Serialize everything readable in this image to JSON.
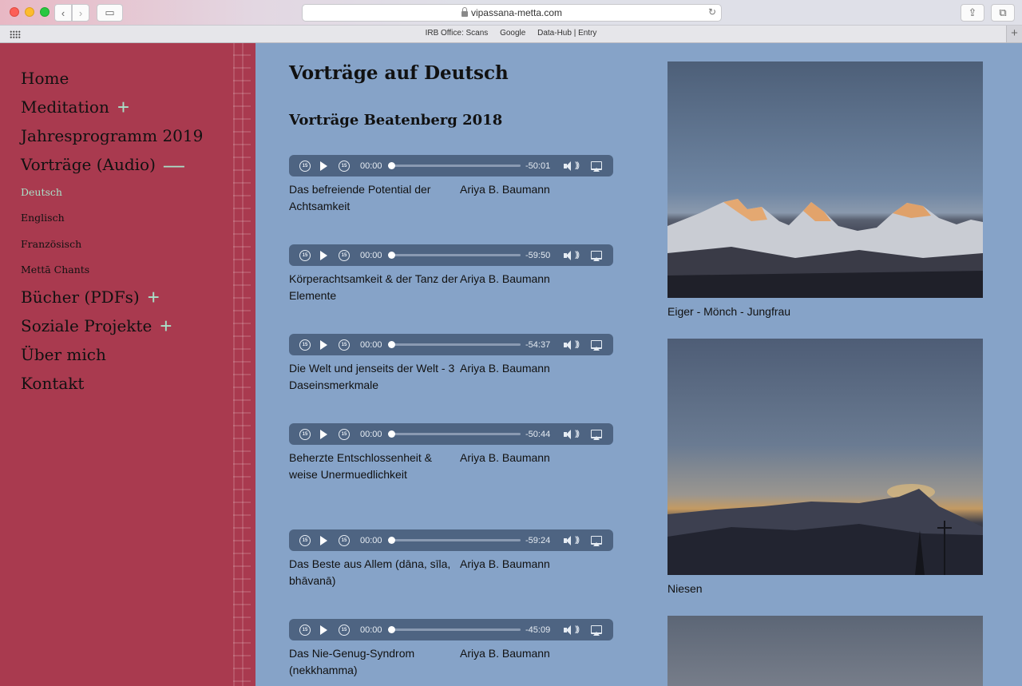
{
  "browser": {
    "url": "vipassana-metta.com",
    "bookmarks": [
      "IRB Office: Scans",
      "Google",
      "Data-Hub | Entry"
    ]
  },
  "sidebar": {
    "items": [
      {
        "label": "Home",
        "sign": ""
      },
      {
        "label": "Meditation",
        "sign": "+"
      },
      {
        "label": "Jahresprogramm 2019",
        "sign": ""
      },
      {
        "label": "Vorträge (Audio)",
        "sign": "—"
      }
    ],
    "subitems": [
      "Deutsch",
      "Englisch",
      "Französisch",
      "Mettā Chants"
    ],
    "items_after": [
      {
        "label": "Bücher (PDFs)",
        "sign": "+"
      },
      {
        "label": "Soziale Projekte",
        "sign": "+"
      },
      {
        "label": "Über mich",
        "sign": ""
      },
      {
        "label": "Kontakt",
        "sign": ""
      }
    ],
    "accent_color": "#a93a4f"
  },
  "main": {
    "title": "Vorträge auf Deutsch",
    "subtitle": "Vorträge Beatenberg 2018",
    "player": {
      "skip_label": "15",
      "current": "00:00"
    },
    "talks": [
      {
        "title": "Das befreiende Potential der Achtsamkeit",
        "author": "Ariya B. Baumann",
        "remaining": "-50:01"
      },
      {
        "title": "Körperachtsamkeit & der Tanz der Elemente",
        "author": "Ariya B. Baumann",
        "remaining": "-59:50"
      },
      {
        "title": "Die Welt und jenseits der Welt - 3 Daseinsmerkmale",
        "author": "Ariya B. Baumann",
        "remaining": "-54:37"
      },
      {
        "title": "Beherzte Entschlossenheit & weise Unermuedlichkeit",
        "author": "Ariya B. Baumann",
        "remaining": "-50:44"
      },
      {
        "title": "Das Beste aus Allem (dāna, sīla, bhāvanā)",
        "author": "Ariya B. Baumann",
        "remaining": "-59:24"
      },
      {
        "title": "Das Nie-Genug-Syndrom (nekkhamma)",
        "author": "Ariya B. Baumann",
        "remaining": "-45:09"
      }
    ],
    "photos": [
      {
        "caption": "Eiger - Mönch - Jungfrau"
      },
      {
        "caption": "Niesen"
      },
      {
        "caption": ""
      }
    ]
  }
}
